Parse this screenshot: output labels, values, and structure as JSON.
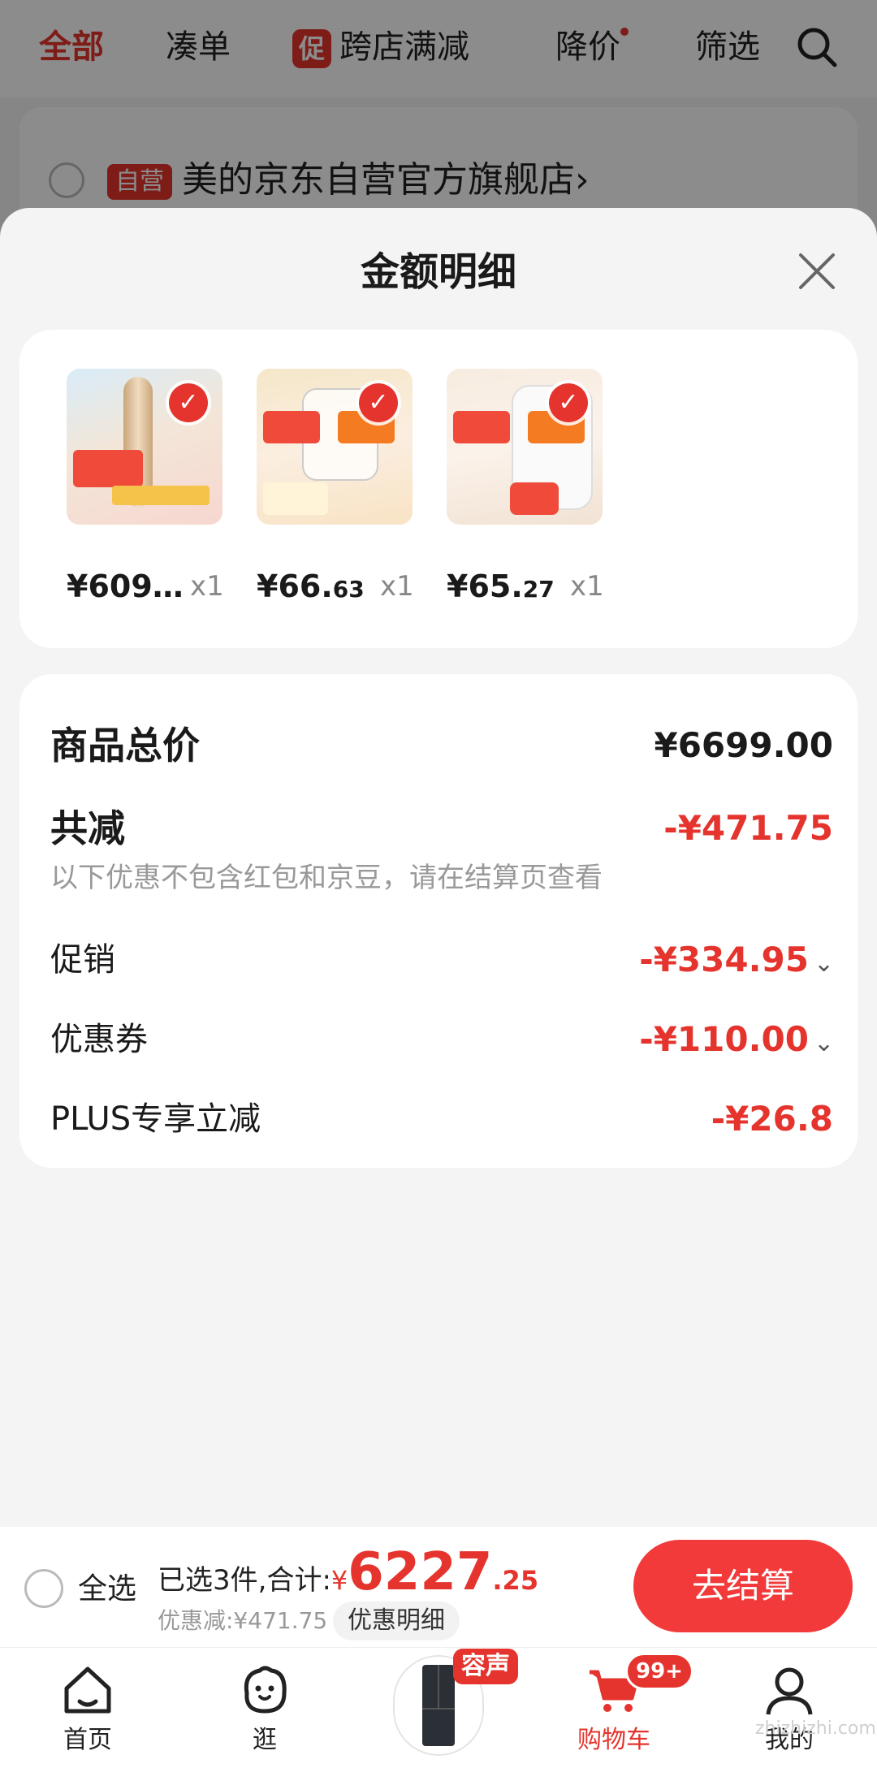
{
  "tabs": {
    "all": "全部",
    "bundle": "凑单",
    "promo_badge": "促",
    "cross_store": "跨店满减",
    "price_drop": "降价",
    "filter": "筛选"
  },
  "store": {
    "badge": "自营",
    "name": "美的京东自营官方旗舰店",
    "chevron": "›"
  },
  "sheet": {
    "title": "金额明细"
  },
  "products": [
    {
      "price_main": "¥609…",
      "price_cents": "",
      "qty": "x1",
      "accent": "#d9b892"
    },
    {
      "price_main": "¥66.",
      "price_cents": "63",
      "qty": "x1",
      "accent": "#e8d2a6"
    },
    {
      "price_main": "¥65.",
      "price_cents": "27",
      "qty": "x1",
      "accent": "#e6e6e6"
    }
  ],
  "amounts": {
    "total_label": "商品总价",
    "total_value": "¥6699.00",
    "reduce_label": "共减",
    "reduce_value": "-¥471.75",
    "note": "以下优惠不包含红包和京豆，请在结算页查看",
    "promo_label": "促销",
    "promo_value": "-¥334.95",
    "coupon_label": "优惠券",
    "coupon_value": "-¥110.00",
    "plus_label": "PLUS专享立减",
    "plus_value": "-¥26.8"
  },
  "checkout": {
    "select_all": "全选",
    "selected_prefix": "已选3件,合计:",
    "currency": "¥",
    "total_int": "6227",
    "total_dec": ".25",
    "discount": "优惠减:¥471.75",
    "detail_button": "优惠明细",
    "checkout_button": "去结算"
  },
  "nav": {
    "home": "首页",
    "browse": "逛",
    "promo_tag": "容声",
    "cart": "购物车",
    "cart_badge": "99+",
    "me": "我的"
  },
  "watermark": "zhizhizhi.com",
  "colors": {
    "accent": "#e5342d",
    "checkout_button": "#f23a3a",
    "background": "#f4f4f4"
  }
}
